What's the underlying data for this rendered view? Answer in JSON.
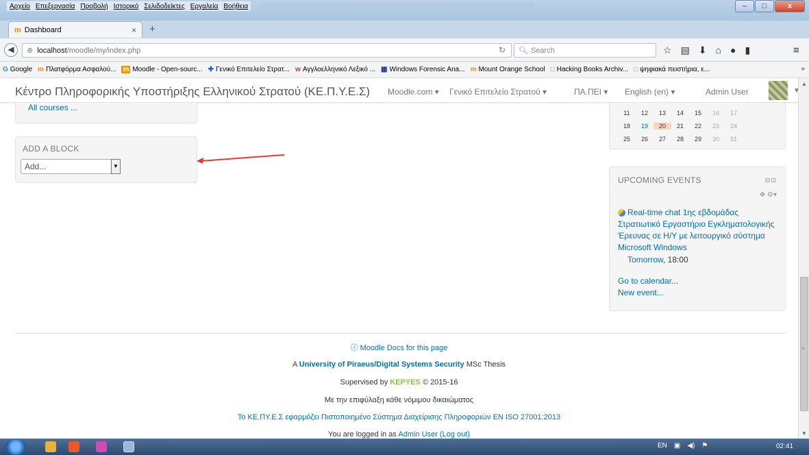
{
  "menu": [
    "Αρχείο",
    "Επεξεργασία",
    "Προβολή",
    "Ιστορικό",
    "Σελιδοδείκτες",
    "Εργαλεία",
    "Βοήθεια"
  ],
  "window_controls": {
    "minimize": "–",
    "maximize": "□",
    "close": "x"
  },
  "tab": {
    "label": "Dashboard",
    "close": "×",
    "new_tab": "+"
  },
  "url": {
    "host": "localhost",
    "path": "/moodle/my/index.php"
  },
  "search": {
    "placeholder": "Search"
  },
  "bookmarks": [
    {
      "icon": "G",
      "label": "Google"
    },
    {
      "icon": "m",
      "label": "Πλατφόρμα Ασφαλού..."
    },
    {
      "icon": "m",
      "label": "Moodle - Open-sourc..."
    },
    {
      "icon": "✚",
      "label": "Γενικό Επιτελείο Στρατ..."
    },
    {
      "icon": "w",
      "label": "Αγγλοελληνικό Λεξικό ..."
    },
    {
      "icon": "▦",
      "label": "Windows Forensic Ana..."
    },
    {
      "icon": "m",
      "label": "Mount Orange School"
    },
    {
      "icon": "□",
      "label": "Hacking Books Archiv..."
    },
    {
      "icon": "□",
      "label": "ψηφιακά πειστήρια, ε..."
    }
  ],
  "bookmarks_more": "»",
  "site": {
    "name": "Κέντρο Πληροφορικής Υποστήριξης Ελληνικού Στρατού (ΚΕ.Π.Υ.Ε.Σ)",
    "nav": [
      "Moodle.com ▾",
      "Γενικό Επιτελείο Στρατού ▾",
      "ΠΑ.ΠΕΙ ▾",
      "English (en) ▾"
    ],
    "user": "Admin User"
  },
  "left": {
    "all_courses": "All courses ...",
    "add_block_title": "ADD A BLOCK",
    "add_select_value": "Add..."
  },
  "calendar": {
    "rows": [
      [
        "11",
        "12",
        "13",
        "14",
        "15",
        "16",
        "17"
      ],
      [
        "18",
        "19",
        "20",
        "21",
        "22",
        "23",
        "24"
      ],
      [
        "25",
        "26",
        "27",
        "28",
        "29",
        "30",
        "31"
      ]
    ]
  },
  "events": {
    "title": "UPCOMING EVENTS",
    "event_text": "Real-time chat 1ης εβδομάδας Στρατιωτικό Εργαστήριο Εγκληματολογικής Έρευνας σε Η/Υ με λειτουργικό σύστημα Microsoft Windows",
    "event_day": "Tomorrow",
    "event_time": ", 18:00",
    "go_to_calendar": "Go to calendar...",
    "new_event": "New event..."
  },
  "footer": {
    "docs": "Moodle Docs for this page",
    "thesis_prefix": "A ",
    "thesis_link": "University of Piraeus/Digital Systems Security",
    "thesis_suffix": " MSc Thesis",
    "supervised_prefix": "Supervised by ",
    "supervised_by": "KEPYES",
    "supervised_suffix": " © 2015-16",
    "rights": "Με την επιφύλαξη κάθε νόμιμου δικαιώματος",
    "iso": "Το ΚΕ.ΠΥ.Ε.Σ εφαρμόζει Πιστοποιημένο Σύστημα Διαχείρισης Πληροφοριών EN ISO 27001:2013",
    "logged_prefix": "You are logged in as ",
    "logged_user": "Admin User",
    "logout": "(Log out)"
  },
  "taskbar": {
    "lang": "EN",
    "clock": "02:41"
  }
}
